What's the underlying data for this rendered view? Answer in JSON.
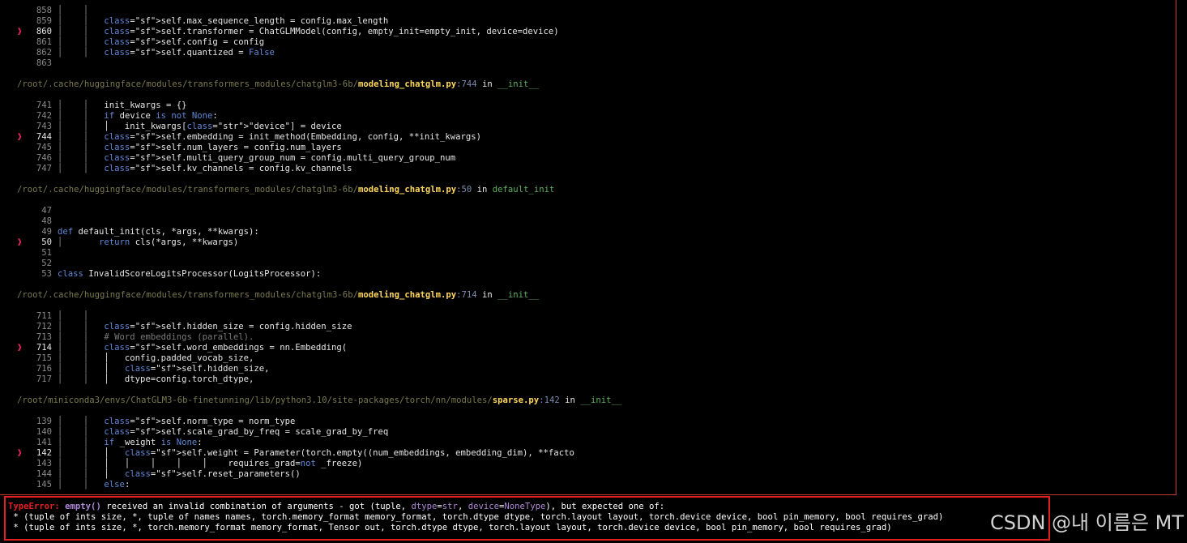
{
  "frames": [
    {
      "path": null,
      "lines": [
        {
          "num": "858",
          "guide": "│    │",
          "code": ""
        },
        {
          "num": "859",
          "guide": "│    │",
          "code": "self.max_sequence_length = config.max_length"
        },
        {
          "num": "860",
          "guide": "│    │",
          "code": "self.transformer = ChatGLMModel(config, empty_init=empty_init, device=device)",
          "current": true
        },
        {
          "num": "861",
          "guide": "│    │",
          "code": "self.config = config"
        },
        {
          "num": "862",
          "guide": "│    │",
          "code": "self.quantized = False"
        },
        {
          "num": "863",
          "guide": "",
          "code": ""
        }
      ]
    },
    {
      "path": {
        "dir": "/root/.cache/huggingface/modules/transformers_modules/chatglm3-6b/",
        "file": "modeling_chatglm.py",
        "lineno": ":744",
        "func": "__init__"
      },
      "lines": [
        {
          "num": "741",
          "guide": "│    │",
          "code": "init_kwargs = {}"
        },
        {
          "num": "742",
          "guide": "│    │",
          "code": "if device is not None:"
        },
        {
          "num": "743",
          "guide": "│    │",
          "code": "│   init_kwargs[\"device\"] = device"
        },
        {
          "num": "744",
          "guide": "│    │",
          "code": "self.embedding = init_method(Embedding, config, **init_kwargs)",
          "current": true
        },
        {
          "num": "745",
          "guide": "│    │",
          "code": "self.num_layers = config.num_layers"
        },
        {
          "num": "746",
          "guide": "│    │",
          "code": "self.multi_query_group_num = config.multi_query_group_num"
        },
        {
          "num": "747",
          "guide": "│    │",
          "code": "self.kv_channels = config.kv_channels"
        }
      ]
    },
    {
      "path": {
        "dir": "/root/.cache/huggingface/modules/transformers_modules/chatglm3-6b/",
        "file": "modeling_chatglm.py",
        "lineno": ":50",
        "func": "default_init"
      },
      "lines": [
        {
          "num": "47",
          "guide": "",
          "code": ""
        },
        {
          "num": "48",
          "guide": "",
          "code": ""
        },
        {
          "num": "49",
          "guide": "",
          "code": "def default_init(cls, *args, **kwargs):"
        },
        {
          "num": "50",
          "guide": "│",
          "code": "    return cls(*args, **kwargs)",
          "current": true
        },
        {
          "num": "51",
          "guide": "",
          "code": ""
        },
        {
          "num": "52",
          "guide": "",
          "code": ""
        },
        {
          "num": "53",
          "guide": "",
          "code": "class InvalidScoreLogitsProcessor(LogitsProcessor):"
        }
      ]
    },
    {
      "path": {
        "dir": "/root/.cache/huggingface/modules/transformers_modules/chatglm3-6b/",
        "file": "modeling_chatglm.py",
        "lineno": ":714",
        "func": "__init__"
      },
      "lines": [
        {
          "num": "711",
          "guide": "│    │",
          "code": ""
        },
        {
          "num": "712",
          "guide": "│    │",
          "code": "self.hidden_size = config.hidden_size"
        },
        {
          "num": "713",
          "guide": "│    │",
          "code": "# Word embeddings (parallel)."
        },
        {
          "num": "714",
          "guide": "│    │",
          "code": "self.word_embeddings = nn.Embedding(",
          "current": true
        },
        {
          "num": "715",
          "guide": "│    │",
          "code": "│   config.padded_vocab_size,"
        },
        {
          "num": "716",
          "guide": "│    │",
          "code": "│   self.hidden_size,"
        },
        {
          "num": "717",
          "guide": "│    │",
          "code": "│   dtype=config.torch_dtype,"
        }
      ]
    },
    {
      "path": {
        "dir": "/root/miniconda3/envs/ChatGLM3-6b-finetunning/lib/python3.10/site-packages/torch/nn/modules/",
        "file": "sparse.py",
        "lineno": ":142",
        "func": "__init__"
      },
      "lines": [
        {
          "num": "139",
          "guide": "│    │",
          "code": "self.norm_type = norm_type"
        },
        {
          "num": "140",
          "guide": "│    │",
          "code": "self.scale_grad_by_freq = scale_grad_by_freq"
        },
        {
          "num": "141",
          "guide": "│    │",
          "code": "if _weight is None:"
        },
        {
          "num": "142",
          "guide": "│    │",
          "code": "│   self.weight = Parameter(torch.empty((num_embeddings, embedding_dim), **facto",
          "current": true
        },
        {
          "num": "143",
          "guide": "│    │",
          "code": "│   │    │    │    │    requires_grad=not _freeze)"
        },
        {
          "num": "144",
          "guide": "│    │",
          "code": "│   self.reset_parameters()"
        },
        {
          "num": "145",
          "guide": "│    │",
          "code": "else:"
        }
      ]
    }
  ],
  "error": {
    "type": "TypeError",
    "colon": ": ",
    "fn": "empty()",
    "msg1": " received an invalid combination of arguments - got (tuple, ",
    "dtype_k": "dtype",
    "eq": "=",
    "dtype_v": "str",
    "comma": ", ",
    "device_k": "device",
    "device_v": "NoneType",
    "msg2": "), but expected one of:",
    "sig1": " * (tuple of ints size, *, tuple of names names, torch.memory_format memory_format, torch.dtype dtype, torch.layout layout, torch.device device, bool pin_memory, bool requires_grad)",
    "sig2": " * (tuple of ints size, *, torch.memory_format memory_format, Tensor out, torch.dtype dtype, torch.layout layout, torch.device device, bool pin_memory, bool requires_grad)"
  },
  "in_word": "in",
  "marker": "❱",
  "watermark": "CSDN @내 이름은 MT"
}
